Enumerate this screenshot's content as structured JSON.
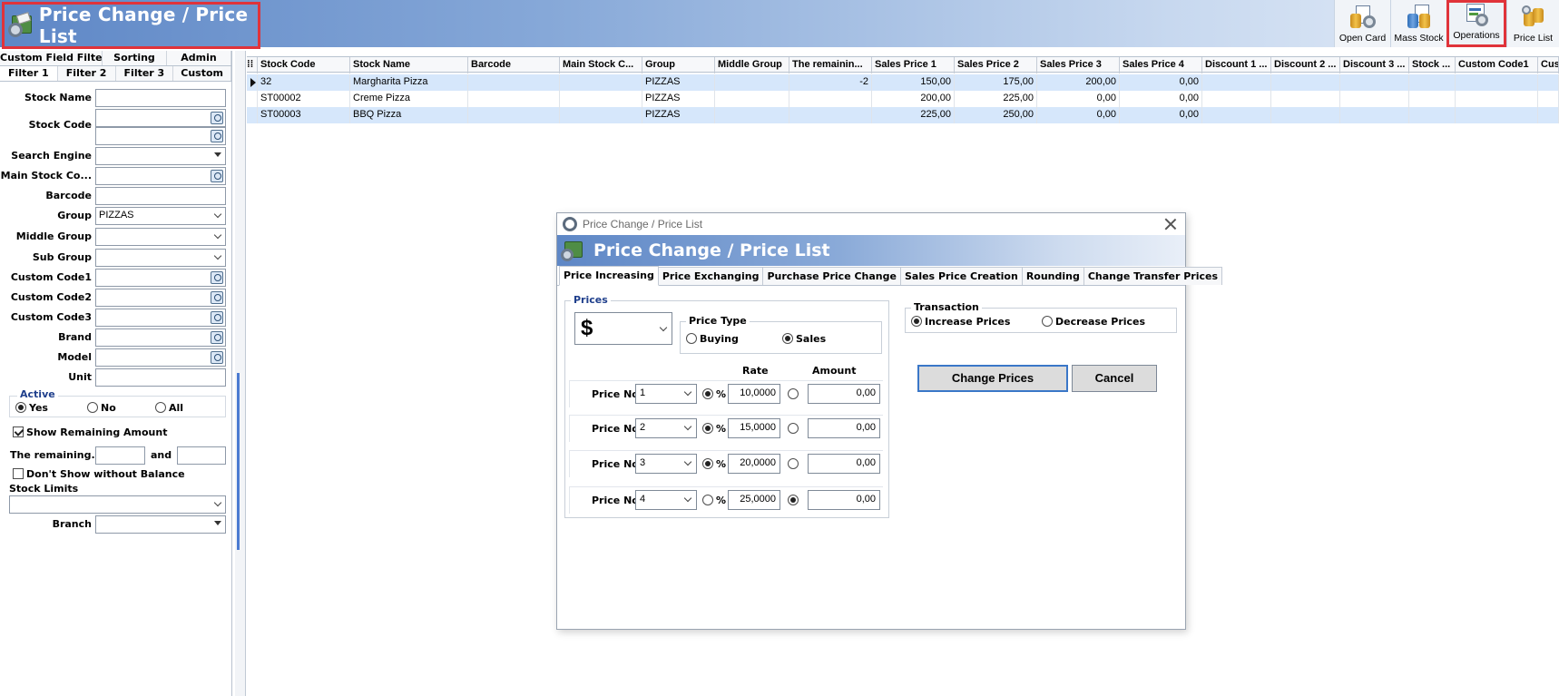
{
  "app": {
    "title": "Price Change / Price List",
    "toolbar": [
      {
        "label": "Open Card",
        "icon": "open-card-icon"
      },
      {
        "label": "Mass Stock",
        "icon": "mass-stock-icon"
      },
      {
        "label": "Operations",
        "icon": "operations-icon",
        "selected": true
      },
      {
        "label": "Price List",
        "icon": "price-list-icon"
      }
    ]
  },
  "filter_panel": {
    "tabs_top": [
      "Custom Field Filter",
      "Sorting",
      "Admin"
    ],
    "tabs_bottom": [
      "Filter 1",
      "Filter 2",
      "Filter 3",
      "Custom"
    ],
    "fields": {
      "stock_name": {
        "label": "Stock Name",
        "value": ""
      },
      "stock_code": {
        "label": "Stock Code",
        "value": ""
      },
      "search_engine": {
        "label": "Search Engine",
        "value": ""
      },
      "main_stock_code": {
        "label": "Main Stock Co...",
        "value": ""
      },
      "barcode": {
        "label": "Barcode",
        "value": ""
      },
      "group": {
        "label": "Group",
        "value": "PIZZAS"
      },
      "middle_group": {
        "label": "Middle Group",
        "value": ""
      },
      "sub_group": {
        "label": "Sub Group",
        "value": ""
      },
      "custom_code1": {
        "label": "Custom Code1",
        "value": ""
      },
      "custom_code2": {
        "label": "Custom Code2",
        "value": ""
      },
      "custom_code3": {
        "label": "Custom Code3",
        "value": ""
      },
      "brand": {
        "label": "Brand",
        "value": ""
      },
      "model": {
        "label": "Model",
        "value": ""
      },
      "unit": {
        "label": "Unit",
        "value": ""
      }
    },
    "active": {
      "label": "Active",
      "options": [
        "Yes",
        "No",
        "All"
      ],
      "selected": "Yes"
    },
    "show_remaining": {
      "label": "Show Remaining Amount",
      "checked": true
    },
    "remaining": {
      "label": "The remaining...",
      "and_label": "and",
      "from": "",
      "to": ""
    },
    "dont_show_without_balance": {
      "label": "Don't Show without Balance",
      "checked": false
    },
    "stock_limits": {
      "label": "Stock Limits",
      "value": ""
    },
    "branch": {
      "label": "Branch",
      "value": ""
    }
  },
  "grid": {
    "columns": [
      "Stock Code",
      "Stock Name",
      "Barcode",
      "Main Stock C...",
      "Group",
      "Middle Group",
      "The remainin...",
      "Sales Price 1",
      "Sales Price 2",
      "Sales Price 3",
      "Sales Price 4",
      "Discount 1 ...",
      "Discount 2 ...",
      "Discount 3 ...",
      "Stock ...",
      "Custom Code1",
      "Cus"
    ],
    "rows": [
      [
        "32",
        "Margharita Pizza",
        "",
        "",
        "PIZZAS",
        "",
        "-2",
        "150,00",
        "175,00",
        "200,00",
        "0,00",
        "",
        "",
        "",
        "",
        "",
        ""
      ],
      [
        "ST00002",
        "Creme Pizza",
        "",
        "",
        "PIZZAS",
        "",
        "",
        "200,00",
        "225,00",
        "0,00",
        "0,00",
        "",
        "",
        "",
        "",
        "",
        ""
      ],
      [
        "ST00003",
        "BBQ Pizza",
        "",
        "",
        "PIZZAS",
        "",
        "",
        "225,00",
        "250,00",
        "0,00",
        "0,00",
        "",
        "",
        "",
        "",
        "",
        ""
      ]
    ]
  },
  "dialog": {
    "window_title": "Price Change / Price List",
    "header_title": "Price Change / Price List",
    "tabs": [
      "Price Increasing",
      "Price Exchanging",
      "Purchase Price Change",
      "Sales Price Creation",
      "Rounding",
      "Change Transfer Prices"
    ],
    "active_tab": "Price Increasing",
    "prices": {
      "legend": "Prices",
      "currency": "$",
      "price_type": {
        "legend": "Price Type",
        "options": [
          "Buying",
          "Sales"
        ],
        "selected": "Sales"
      },
      "rate_header": "Rate",
      "amount_header": "Amount",
      "row_label": "Price No",
      "percent_symbol": "%",
      "rows": [
        {
          "price_no": "1",
          "mode": "percent",
          "rate": "10,0000",
          "amount": "0,00"
        },
        {
          "price_no": "2",
          "mode": "percent",
          "rate": "15,0000",
          "amount": "0,00"
        },
        {
          "price_no": "3",
          "mode": "percent",
          "rate": "20,0000",
          "amount": "0,00"
        },
        {
          "price_no": "4",
          "mode": "amount",
          "rate": "25,0000",
          "amount": "0,00"
        }
      ]
    },
    "transaction": {
      "legend": "Transaction",
      "options": [
        "Increase Prices",
        "Decrease Prices"
      ],
      "selected": "Increase Prices"
    },
    "buttons": {
      "change": "Change Prices",
      "cancel": "Cancel"
    }
  }
}
